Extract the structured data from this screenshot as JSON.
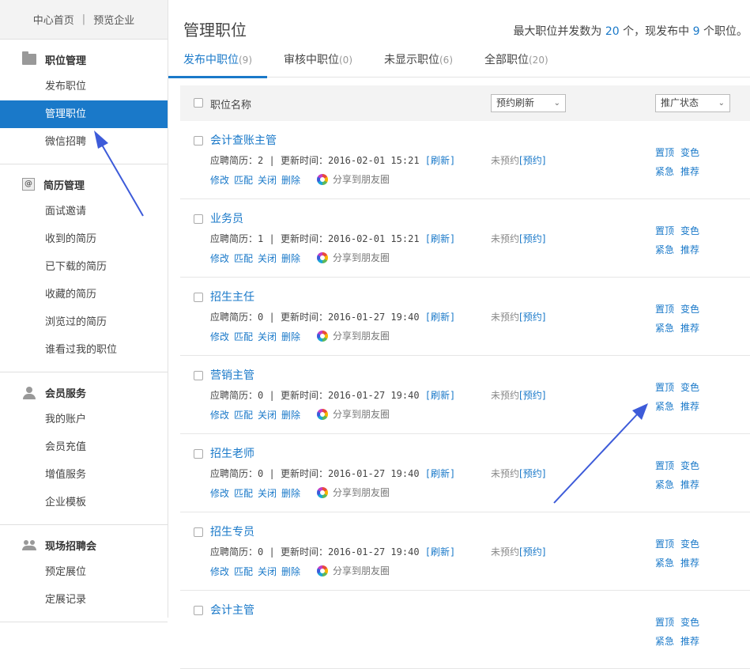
{
  "sidebar": {
    "top_links": [
      "中心首页",
      "预览企业"
    ],
    "sections": [
      {
        "title": "职位管理",
        "icon": "folder-icon",
        "items": [
          "发布职位",
          "管理职位",
          "微信招聘"
        ],
        "active": 1
      },
      {
        "title": "简历管理",
        "icon": "resume-icon",
        "items": [
          "面试邀请",
          "收到的简历",
          "已下载的简历",
          "收藏的简历",
          "浏览过的简历",
          "谁看过我的职位"
        ]
      },
      {
        "title": "会员服务",
        "icon": "person-icon",
        "items": [
          "我的账户",
          "会员充值",
          "增值服务",
          "企业模板"
        ]
      },
      {
        "title": "现场招聘会",
        "icon": "group-icon",
        "items": [
          "预定展位",
          "定展记录"
        ]
      }
    ]
  },
  "main": {
    "title": "管理职位",
    "quota": {
      "prefix": "最大职位并发数为",
      "max": "20",
      "mid": "个，现发布中",
      "current": "9",
      "suffix": "个职位。"
    },
    "tabs": [
      {
        "label": "发布中职位",
        "count": "(9)"
      },
      {
        "label": "审核中职位",
        "count": "(0)"
      },
      {
        "label": "未显示职位",
        "count": "(6)"
      },
      {
        "label": "全部职位",
        "count": "(20)"
      }
    ],
    "list_header": {
      "name_label": "职位名称",
      "refresh_select": "预约刷新",
      "promo_select": "推广状态"
    },
    "labels": {
      "resumes": "应聘简历：",
      "updated": "更新时间：",
      "refresh_link": "[刷新]",
      "ops": [
        "修改",
        "匹配",
        "关闭",
        "删除"
      ],
      "share": "分享到朋友圈",
      "not_scheduled": "未预约",
      "schedule_link": "[预约]",
      "promo_row1": [
        "置顶",
        "变色"
      ],
      "promo_row2": [
        "紧急",
        "推荐"
      ]
    },
    "jobs": [
      {
        "title": "会计查账主管",
        "resumes": "2",
        "updated": "2016-02-01 15:21"
      },
      {
        "title": "业务员",
        "resumes": "1",
        "updated": "2016-02-01 15:21"
      },
      {
        "title": "招生主任",
        "resumes": "0",
        "updated": "2016-01-27 19:40"
      },
      {
        "title": "营销主管",
        "resumes": "0",
        "updated": "2016-01-27 19:40"
      },
      {
        "title": "招生老师",
        "resumes": "0",
        "updated": "2016-01-27 19:40"
      },
      {
        "title": "招生专员",
        "resumes": "0",
        "updated": "2016-01-27 19:40"
      },
      {
        "title": "会计主管",
        "resumes": "",
        "updated": ""
      }
    ]
  },
  "colors": {
    "accent": "#1a79c9",
    "arrow": "#3d5bd9"
  }
}
